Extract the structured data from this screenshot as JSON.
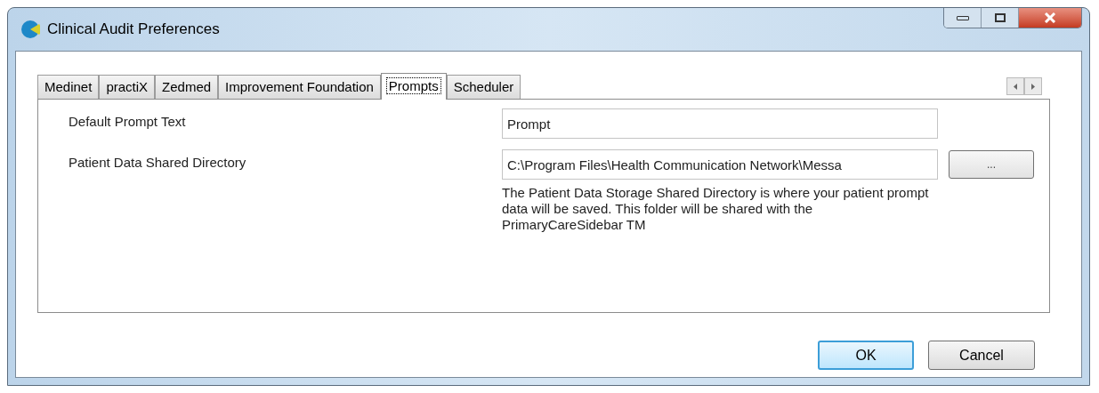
{
  "window": {
    "title": "Clinical Audit Preferences"
  },
  "tabs": [
    {
      "label": "Medinet",
      "selected": false
    },
    {
      "label": "practiX",
      "selected": false
    },
    {
      "label": "Zedmed",
      "selected": false
    },
    {
      "label": "Improvement Foundation",
      "selected": false
    },
    {
      "label": "Prompts",
      "selected": true
    },
    {
      "label": "Scheduler",
      "selected": false
    }
  ],
  "fields": [
    {
      "label": "Default Prompt Text",
      "value": "Prompt"
    },
    {
      "label": "Patient Data Shared Directory",
      "value": "C:\\Program Files\\Health Communication Network\\Messa",
      "browse_button": "...",
      "help": "The Patient Data Storage Shared Directory is where your patient prompt data will be saved. This folder will be shared with the PrimaryCareSidebar TM"
    }
  ],
  "buttons": [
    {
      "label": "OK",
      "default": true
    },
    {
      "label": "Cancel",
      "default": false
    }
  ]
}
